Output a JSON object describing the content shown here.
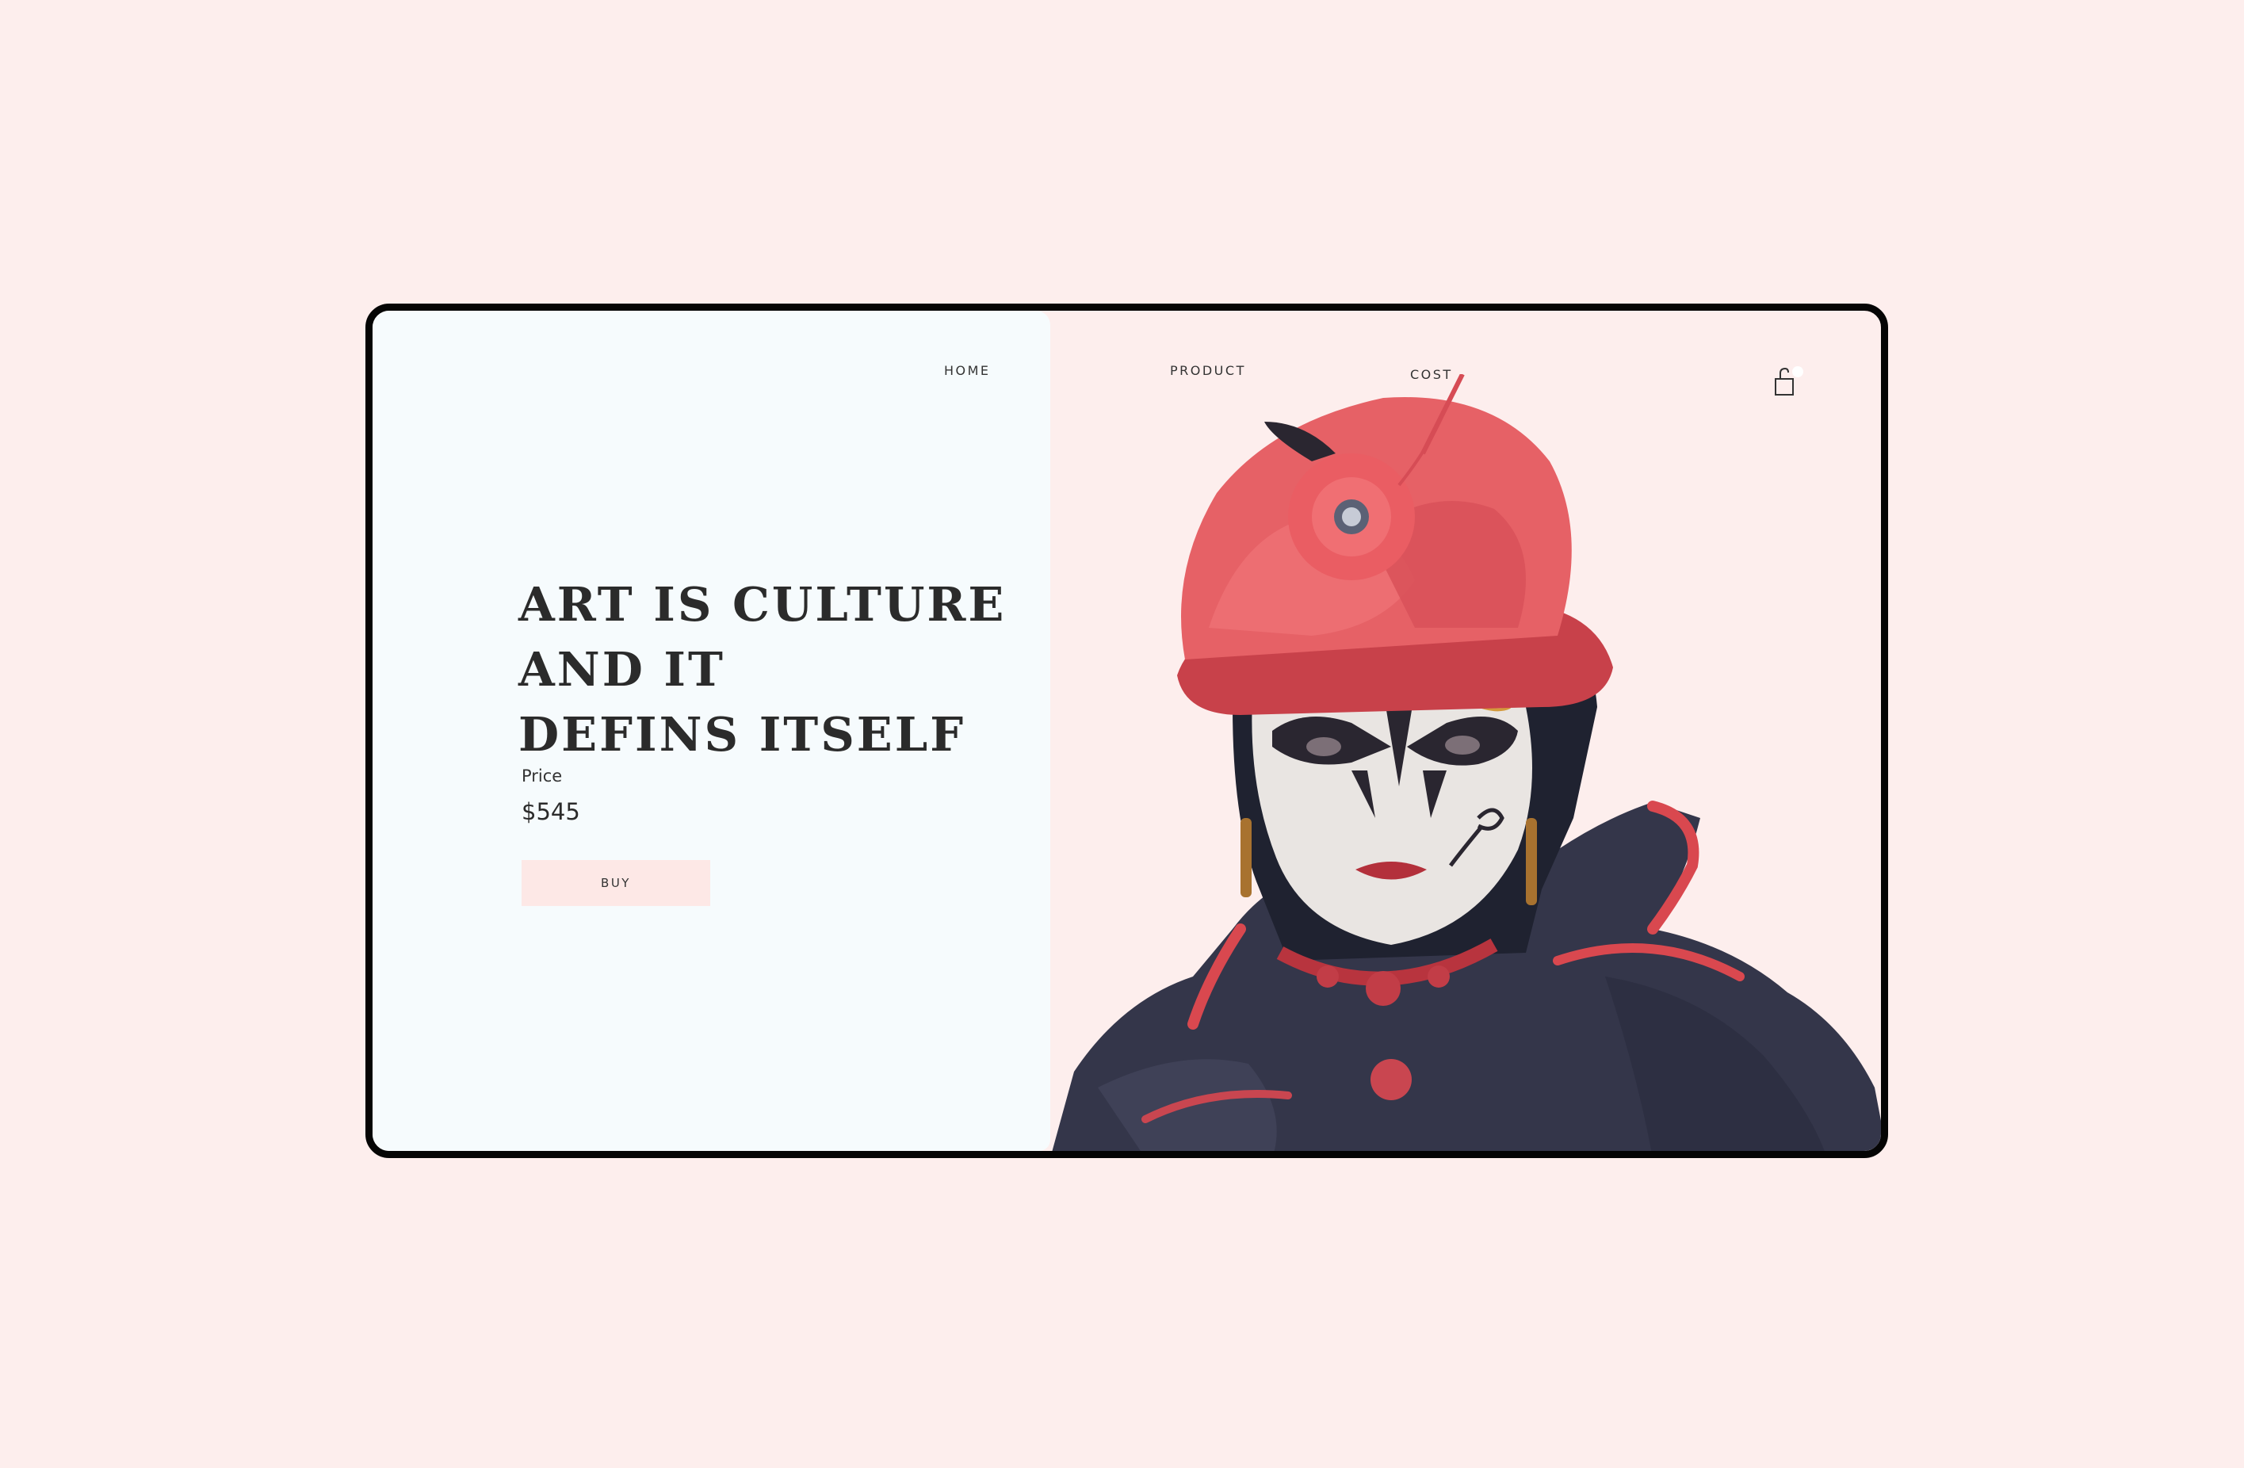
{
  "nav": {
    "home": "HOME",
    "product": "PRODUCT",
    "cost": "COST"
  },
  "hero": {
    "headline_lines": [
      "ART IS CULTURE",
      "AND IT",
      "DEFINS ITSELF"
    ],
    "price_label": "Price",
    "price_value": "$545",
    "buy_label": "BUY"
  },
  "icons": {
    "cart": "shopping-bag-icon"
  },
  "colors": {
    "page_background": "#fdeeed",
    "left_panel": "#f6fbfd",
    "frame_border": "#050505",
    "button_background": "#fde8e6",
    "text": "#2b2b2b",
    "accent_red": "#e85a5e"
  }
}
